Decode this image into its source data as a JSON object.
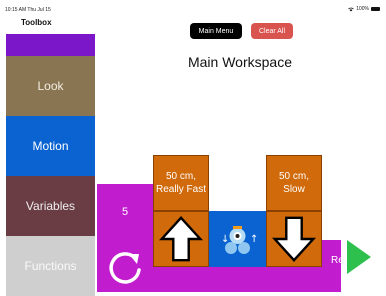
{
  "status": {
    "time": "10:15 AM  Thu Jul 15",
    "battery": "100%"
  },
  "toolbox": {
    "title": "Toolbox",
    "categories": [
      "Look",
      "Motion",
      "Variables",
      "Functions"
    ]
  },
  "header": {
    "main_menu": "Main Menu",
    "clear_all": "Clear All",
    "title": "Main Workspace"
  },
  "program": {
    "variable_value": "5",
    "left_speed": "50 cm, Really Fast",
    "right_speed": "50 cm, Slow",
    "cutoff_text": "Re"
  },
  "colors": {
    "purple": "#c11ccd",
    "orange": "#d06a0b",
    "blue": "#0a63d0",
    "play": "#2ec04d",
    "clear": "#d9534f"
  },
  "icons": [
    "loop-icon",
    "up-arrow-icon",
    "down-arrow-icon",
    "robot-icon",
    "play-icon",
    "wifi-icon",
    "battery-icon"
  ]
}
